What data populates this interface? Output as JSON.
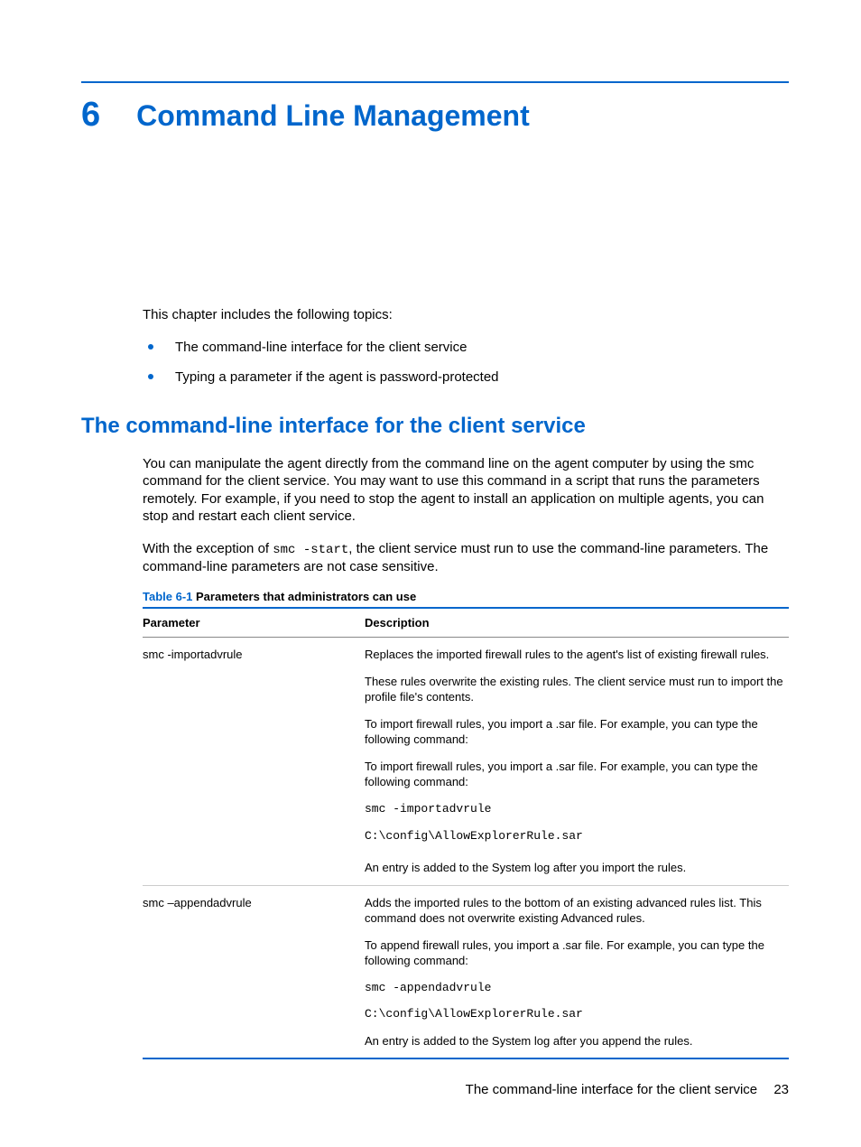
{
  "chapter": {
    "number": "6",
    "title": "Command Line Management"
  },
  "intro": "This chapter includes the following topics:",
  "topics": [
    "The command-line interface for the client service",
    "Typing a parameter if the agent is password-protected"
  ],
  "section": {
    "title": "The command-line interface for the client service",
    "para1": "You can manipulate the agent directly from the command line on the agent computer by using the smc command for the client service. You may want to use this command in a script that runs the parameters remotely. For example, if you need to stop the agent to install an application on multiple agents, you can stop and restart each client service.",
    "para2_a": "With the exception of ",
    "para2_code": "smc -start",
    "para2_b": ", the client service must run to use the command-line parameters. The command-line parameters are not case sensitive."
  },
  "table": {
    "caption_label": "Table 6-1",
    "caption_text": "  Parameters that administrators can use",
    "headers": {
      "param": "Parameter",
      "desc": "Description"
    },
    "rows": [
      {
        "param": "smc -importadvrule",
        "desc": {
          "p1": "Replaces the imported firewall rules to the agent's list of existing firewall rules.",
          "p2": "These rules overwrite the existing rules. The client service must run to import the profile file's contents.",
          "p3": "To import firewall rules, you import a .sar file. For example, you can type the following command:",
          "p4": "To import firewall rules, you import a .sar file. For example, you can type the following command:",
          "code1": "smc -importadvrule",
          "code2": "C:\\config\\AllowExplorerRule.sar",
          "p5": "An entry is added to the System log after you import the rules."
        }
      },
      {
        "param": "smc –appendadvrule",
        "desc": {
          "p1": "Adds the imported rules to the bottom of an existing advanced rules list. This command does not overwrite existing Advanced rules.",
          "p2": "To append firewall rules, you import a .sar file. For example, you can type the following command:",
          "code1": "smc -appendadvrule",
          "code2": "C:\\config\\AllowExplorerRule.sar",
          "p3": "An entry is added to the System log after you append the rules."
        }
      }
    ]
  },
  "footer": {
    "text": "The command-line interface for the client service",
    "page": "23"
  }
}
